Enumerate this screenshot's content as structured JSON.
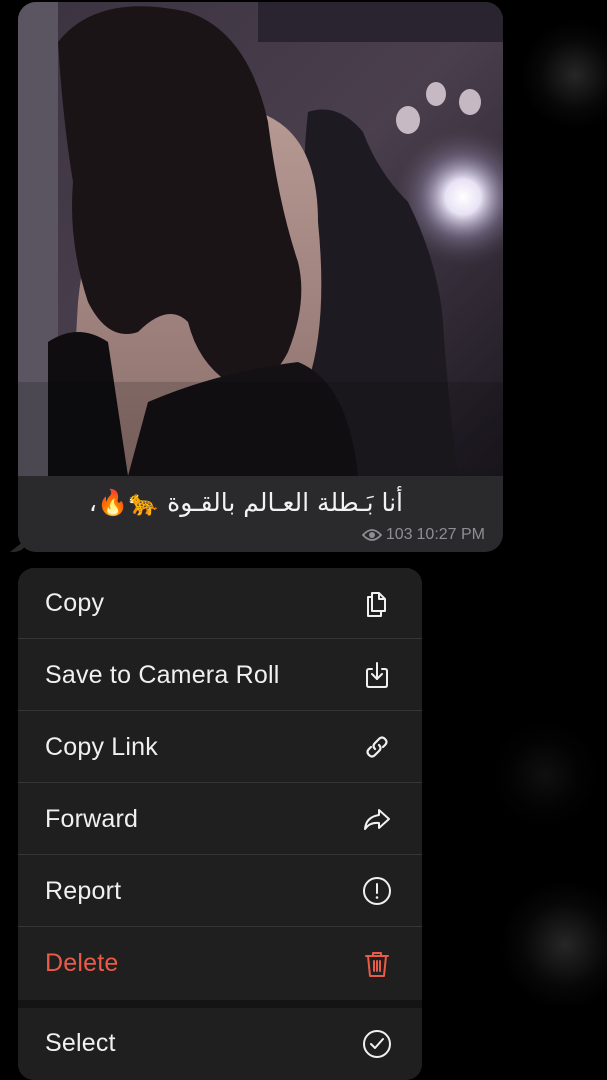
{
  "message": {
    "caption": "أنا بَـطلة العـالم بالقـوة 🐆🔥،",
    "views": "103",
    "time": "10:27 PM"
  },
  "menu": {
    "items": [
      {
        "label": "Copy",
        "icon": "copy-icon"
      },
      {
        "label": "Save to Camera Roll",
        "icon": "save-download-icon"
      },
      {
        "label": "Copy Link",
        "icon": "link-icon"
      },
      {
        "label": "Forward",
        "icon": "forward-arrow-icon"
      },
      {
        "label": "Report",
        "icon": "exclamation-circle-icon"
      },
      {
        "label": "Delete",
        "icon": "trash-icon"
      },
      {
        "label": "Select",
        "icon": "checkmark-circle-icon"
      }
    ]
  },
  "colors": {
    "danger": "#ea5a47",
    "menu_bg": "#1f1f1f",
    "bubble_bg": "#2a2a2c"
  }
}
